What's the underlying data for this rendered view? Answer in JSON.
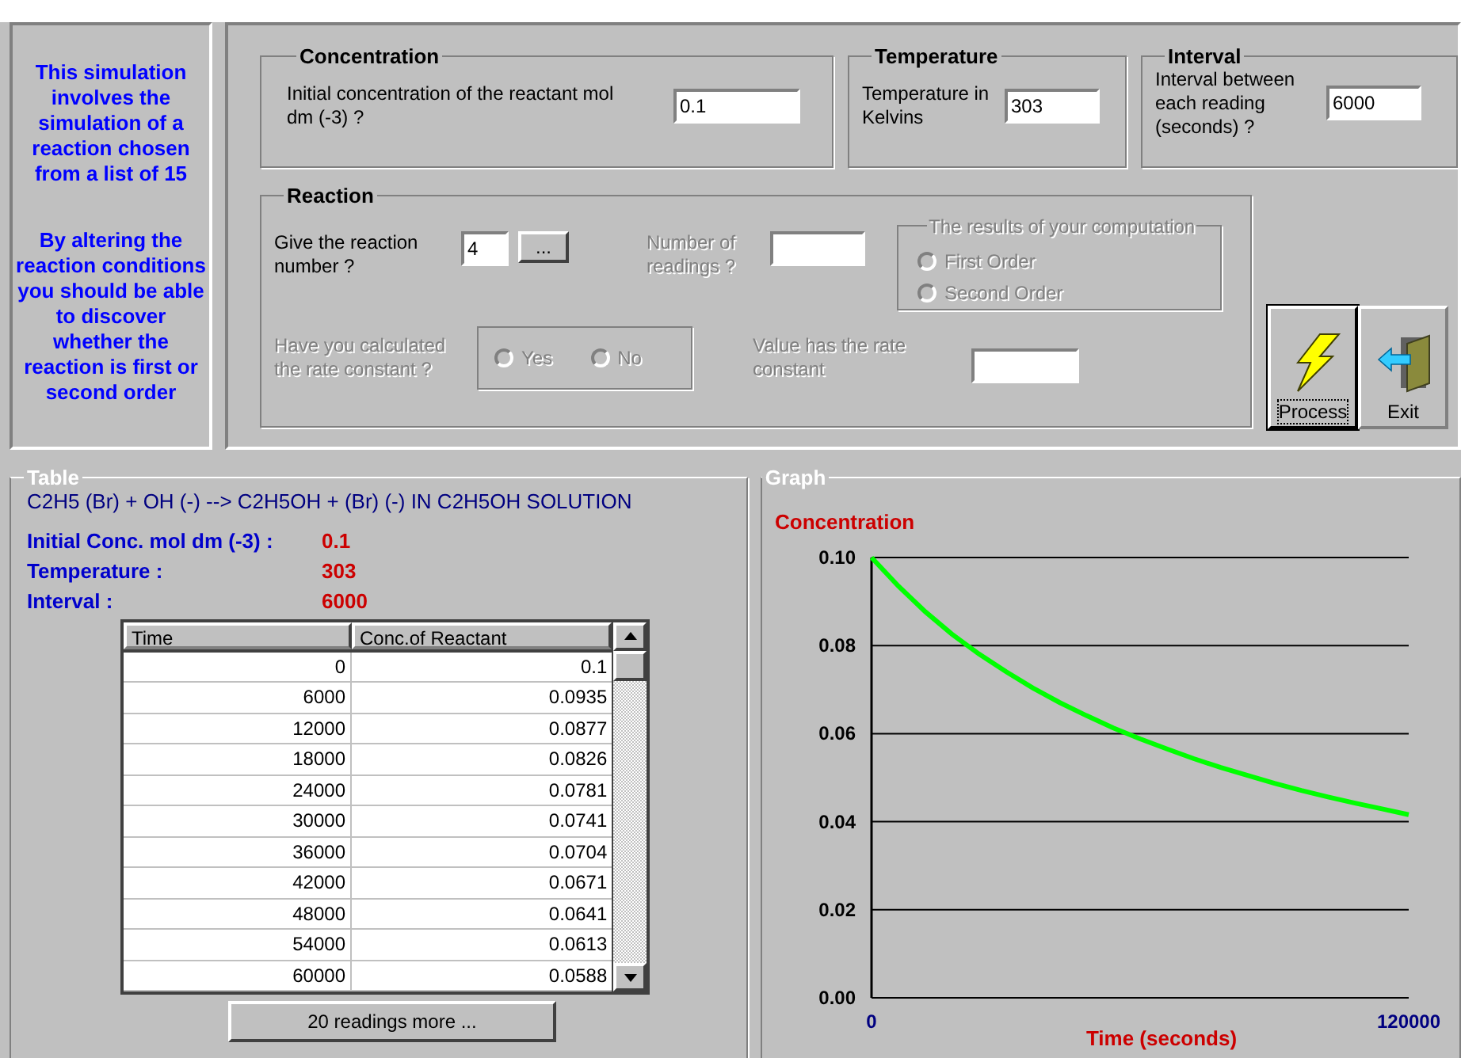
{
  "info_panel": {
    "paragraphs": [
      "This simulation involves the simulation of a reaction chosen from a list of 15",
      "By altering the reaction conditions you should be able to discover whether the reaction is first or second order"
    ]
  },
  "concentration": {
    "title": "Concentration",
    "label": "Initial concentration of the reactant mol dm (-3) ?",
    "value": "0.1"
  },
  "temperature": {
    "title": "Temperature",
    "label": "Temperature in Kelvins",
    "value": "303"
  },
  "interval": {
    "title": "Interval",
    "label": "Interval between each reading (seconds) ?",
    "value": "6000"
  },
  "reaction": {
    "title": "Reaction",
    "number": {
      "label": "Give the reaction number ?",
      "value": "4",
      "browse_button": "...",
      "disabled": false
    },
    "readings": {
      "label": "Number of readings ?",
      "disabled": true
    },
    "results": {
      "title": "The results of your computation",
      "disabled": true,
      "options": [
        {
          "label": "First Order",
          "selected": false
        },
        {
          "label": "Second Order",
          "selected": false
        }
      ]
    },
    "calculated": {
      "label": "Have you calculated the rate constant ?",
      "disabled": true,
      "options": [
        {
          "label": "Yes",
          "selected": false
        },
        {
          "label": "No",
          "selected": false
        }
      ]
    },
    "rate_constant": {
      "label": "Value has the rate constant",
      "disabled": true
    }
  },
  "buttons": [
    {
      "label": "Process",
      "kind": "process",
      "focused": true
    },
    {
      "label": "Exit",
      "kind": "exit",
      "focused": false
    }
  ],
  "table": {
    "title": "Table",
    "equation": "C2H5 (Br) + OH (-) --> C2H5OH + (Br) (-) IN C2H5OH SOLUTION",
    "summary": [
      {
        "label": "Initial Conc. mol dm (-3) :",
        "value": "0.1"
      },
      {
        "label": "Temperature :",
        "value": "303"
      },
      {
        "label": "Interval :",
        "value": "6000"
      }
    ],
    "columns": [
      "Time",
      "Conc.of Reactant"
    ],
    "rows": [
      [
        "0",
        "0.1"
      ],
      [
        "6000",
        "0.0935"
      ],
      [
        "12000",
        "0.0877"
      ],
      [
        "18000",
        "0.0826"
      ],
      [
        "24000",
        "0.0781"
      ],
      [
        "30000",
        "0.0741"
      ],
      [
        "36000",
        "0.0704"
      ],
      [
        "42000",
        "0.0671"
      ],
      [
        "48000",
        "0.0641"
      ],
      [
        "54000",
        "0.0613"
      ],
      [
        "60000",
        "0.0588"
      ]
    ],
    "more_button": "20 readings more ..."
  },
  "graph": {
    "title": "Graph",
    "chart_data": {
      "type": "line",
      "ylabel": "Concentration",
      "xlabel": "Time (seconds)",
      "x": [
        0,
        6000,
        12000,
        18000,
        24000,
        30000,
        36000,
        42000,
        48000,
        54000,
        60000,
        66000,
        72000,
        78000,
        84000,
        90000,
        96000,
        102000,
        108000,
        114000,
        120000
      ],
      "values": [
        0.1,
        0.0935,
        0.0877,
        0.0826,
        0.0781,
        0.0741,
        0.0704,
        0.0671,
        0.0641,
        0.0613,
        0.0588,
        0.0565,
        0.0543,
        0.0523,
        0.0505,
        0.0487,
        0.0471,
        0.0456,
        0.0442,
        0.0429,
        0.0416
      ],
      "xlim": [
        0,
        120000
      ],
      "ylim": [
        0,
        0.1
      ],
      "grid": true,
      "xticks": [
        0,
        120000
      ],
      "yticks": [
        {
          "value": 0,
          "label": "0.00"
        },
        {
          "value": 0.02,
          "label": "0.02"
        },
        {
          "value": 0.04,
          "label": "0.04"
        },
        {
          "value": 0.06,
          "label": "0.06"
        },
        {
          "value": 0.08,
          "label": "0.08"
        },
        {
          "value": 0.1,
          "label": "0.10"
        }
      ]
    }
  }
}
